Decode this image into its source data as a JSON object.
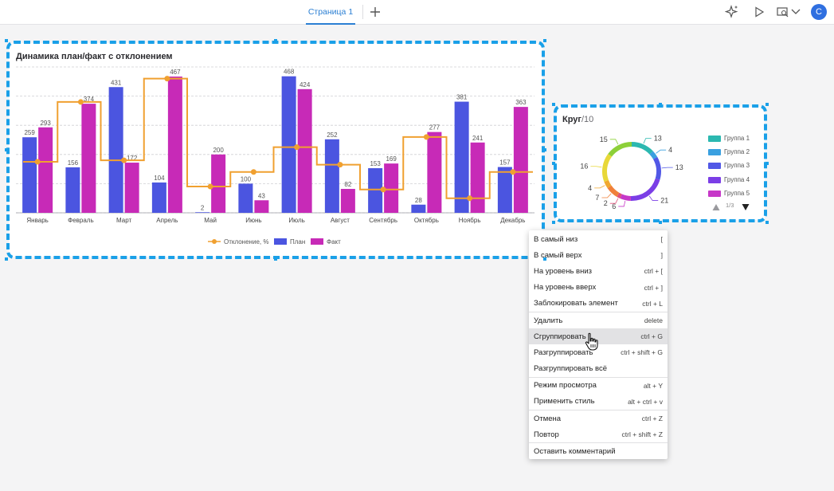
{
  "header": {
    "tab_label": "Страница 1",
    "add_tab_icon": "plus-icon",
    "icons": [
      "sparkle-icon",
      "play-icon",
      "preview-icon",
      "chevron-down-icon"
    ],
    "avatar_letter": "С",
    "accent": "#2b7fd3"
  },
  "bar_widget": {
    "title": "Динамика план/факт с отклонением",
    "legend": {
      "deviation": "Отклонение, %",
      "plan": "План",
      "fact": "Факт"
    }
  },
  "pie_widget": {
    "title": "Круг",
    "subtitle": "/10",
    "legend": [
      "Группа 1",
      "Группа 2",
      "Группа 3",
      "Группа 4",
      "Группа 5"
    ],
    "pager": "1/3"
  },
  "chart_data": [
    {
      "type": "bar",
      "title": "Динамика план/факт с отклонением",
      "categories": [
        "Январь",
        "Февраль",
        "Март",
        "Апрель",
        "Май",
        "Июнь",
        "Июль",
        "Август",
        "Сентябрь",
        "Октябрь",
        "Ноябрь",
        "Декабрь"
      ],
      "ylim": [
        0,
        500
      ],
      "grid": true,
      "legend_position": "bottom",
      "series": [
        {
          "name": "План",
          "color": "#4b55e0",
          "values": [
            259,
            156,
            431,
            104,
            2,
            100,
            468,
            252,
            153,
            28,
            381,
            157
          ]
        },
        {
          "name": "Факт",
          "color": "#c72ab7",
          "values": [
            293,
            374,
            172,
            467,
            200,
            43,
            424,
            82,
            169,
            277,
            241,
            363
          ]
        },
        {
          "name": "Отклонение, %",
          "type": "step-line",
          "color": "#f0a030",
          "values": [
            175,
            380,
            180,
            460,
            90,
            140,
            225,
            165,
            80,
            260,
            50,
            140
          ]
        }
      ]
    },
    {
      "type": "pie",
      "title": "Круг",
      "subtitle": "/10",
      "labels": [
        "13",
        "4",
        "13",
        "21",
        "6",
        "2",
        "7",
        "4",
        "16",
        "15"
      ],
      "values": [
        13,
        4,
        13,
        21,
        6,
        2,
        7,
        4,
        16,
        15
      ],
      "colors": [
        "#2bb8b0",
        "#3aa0e0",
        "#5158e6",
        "#7b3ee6",
        "#c638c8",
        "#e0507a",
        "#f0803a",
        "#f0a830",
        "#e8d838",
        "#8dd038"
      ],
      "legend_position": "right"
    }
  ],
  "context_menu": {
    "items": [
      {
        "label": "В самый низ",
        "shortcut": "["
      },
      {
        "label": "В самый верх",
        "shortcut": "]"
      },
      {
        "label": "На уровень вниз",
        "shortcut": "ctrl + ["
      },
      {
        "label": "На уровень вверх",
        "shortcut": "ctrl + ]"
      },
      {
        "label": "Заблокировать элемент",
        "shortcut": "ctrl + L"
      },
      {
        "label": "Удалить",
        "shortcut": "delete"
      },
      {
        "label": "Сгруппировать",
        "shortcut": "ctrl + G"
      },
      {
        "label": "Разгруппировать",
        "shortcut": "ctrl + shift + G"
      },
      {
        "label": "Разгруппировать всё",
        "shortcut": ""
      },
      {
        "label": "Режим просмотра",
        "shortcut": "alt + Y"
      },
      {
        "label": "Применить стиль",
        "shortcut": "alt + ctrl + v"
      },
      {
        "label": "Отмена",
        "shortcut": "ctrl + Z"
      },
      {
        "label": "Повтор",
        "shortcut": "ctrl + shift + Z"
      },
      {
        "label": "Оставить комментарий",
        "shortcut": ""
      }
    ]
  }
}
